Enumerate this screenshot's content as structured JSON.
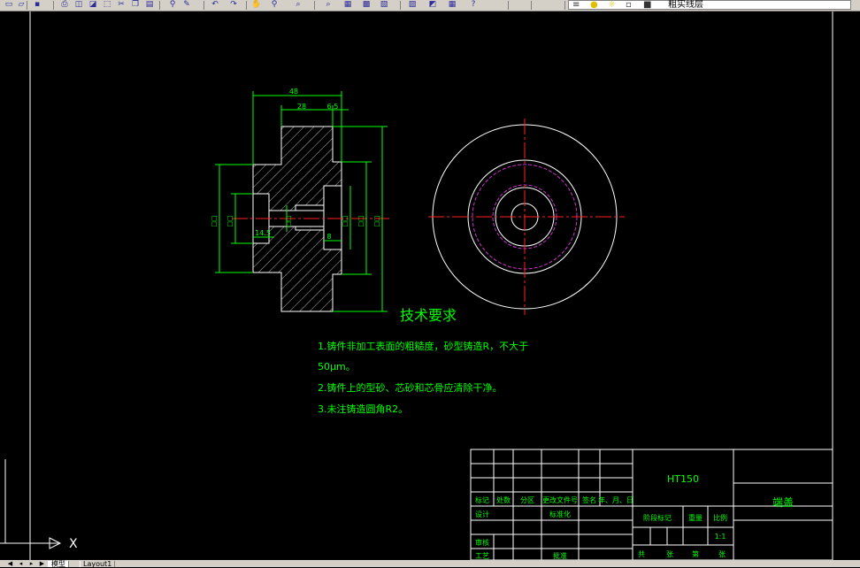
{
  "toolbar": {
    "icons": [
      "new-icon",
      "open-icon",
      "save-icon",
      "print-icon",
      "preview-icon",
      "publish-icon",
      "plot-icon",
      "cut-icon",
      "copy-icon",
      "paste-icon",
      "match-icon",
      "brush-icon",
      "undo-icon",
      "redo-icon",
      "pan-icon",
      "zoom-realtime-icon",
      "zoom-window-icon",
      "zoom-previous-icon",
      "properties-icon",
      "design-center-icon",
      "tool-palette-icon",
      "sheet-set-icon",
      "markup-icon",
      "calc-icon",
      "help-icon",
      "layer-manager-icon",
      "bulb-icon",
      "sun-icon",
      "lock-icon",
      "color-icon"
    ],
    "layer_name": "粗实线层"
  },
  "drawing": {
    "dim_48": "48",
    "dim_28": "28",
    "dim_6_5": "6.5",
    "dim_8": "8",
    "dim_14_5": "14.5",
    "diam_labels": [
      "□□",
      "□□",
      "□□",
      "□□",
      "□□",
      "□□"
    ]
  },
  "notes": {
    "title": "技术要求",
    "line1": "1.铸件非加工表面的粗糙度，砂型铸造R，不大于",
    "line1b": "50μm。",
    "line2": "2.铸件上的型砂、芯砂和芯骨应清除干净。",
    "line3": "3.未注铸造圆角R2。"
  },
  "title_block": {
    "material": "HT150",
    "part_name": "端盖",
    "header_labels": [
      "标记",
      "处数",
      "分区",
      "更改文件号",
      "签名",
      "年、月、日"
    ],
    "design": "设计",
    "standardization": "标准化",
    "stage_mark": "阶段标记",
    "weight": "重量",
    "scale_label": "比例",
    "scale_value": "1:1",
    "review": "审核",
    "process": "工艺",
    "approve": "批准",
    "sheet_total": "共",
    "sheet_unit": "张",
    "sheet_no": "第",
    "sheet_unit2": "张"
  },
  "ucs": {
    "x_label": "X"
  },
  "tabs": {
    "model": "模型",
    "layout1": "Layout1"
  },
  "colors": {
    "background": "#000000",
    "geometry": "#ffffff",
    "dimension": "#00ff00",
    "center": "#ff0000",
    "hidden": "#cc33cc",
    "hatch": "#ffffff"
  }
}
